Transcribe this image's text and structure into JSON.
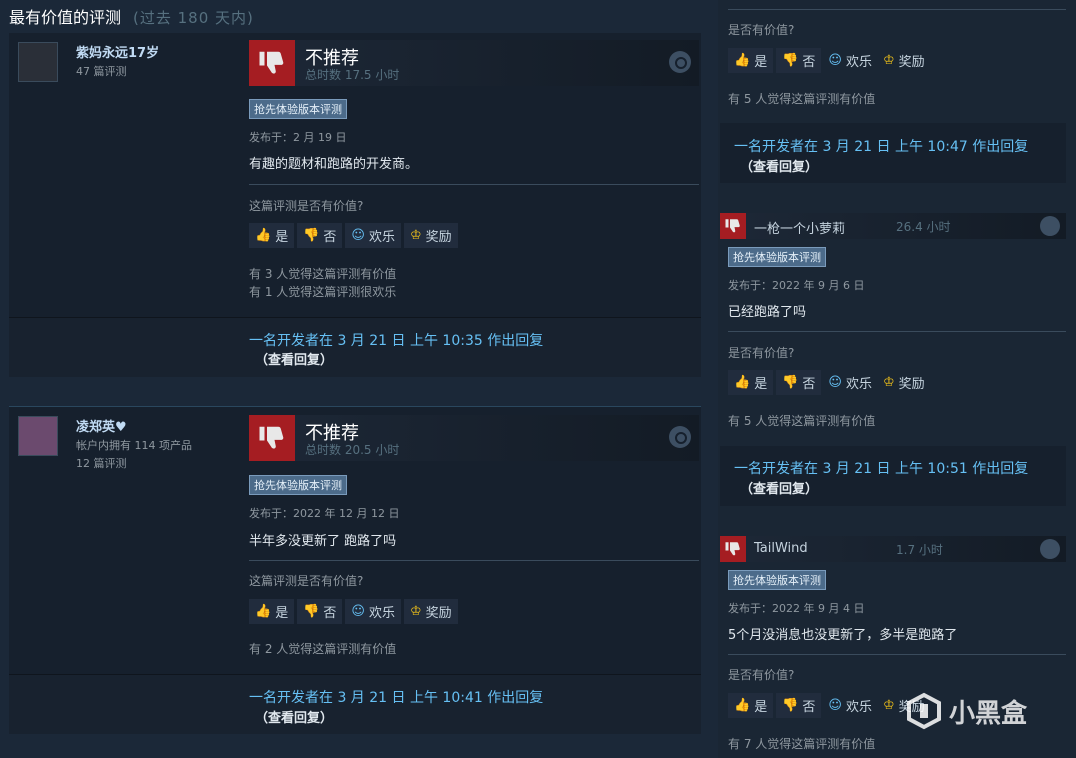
{
  "section": {
    "title": "最有价值的评测",
    "subtitle": "(过去 180 天内)"
  },
  "reviews": [
    {
      "author": "紫妈永远17岁",
      "meta1": "47 篇评测",
      "meta2": "",
      "verdict": "不推荐",
      "hours": "总时数 17.5 小时",
      "tag": "抢先体验版本评测",
      "posted": "发布于：2 月 19 日",
      "text": "有趣的题材和跑路的开发商。",
      "helpful_q": "这篇评测是否有价值?",
      "stat1": "有 3 人觉得这篇评测有价值",
      "stat2": "有 1 人觉得这篇评测很欢乐",
      "dev_reply": "一名开发者在 3 月 21 日 上午 10:35 作出回复",
      "view_reply": "（查看回复）"
    },
    {
      "author": "凌郑英♥",
      "meta1": "帐户内拥有 114 项产品",
      "meta2": "12 篇评测",
      "verdict": "不推荐",
      "hours": "总时数 20.5 小时",
      "tag": "抢先体验版本评测",
      "posted": "发布于：2022 年 12 月 12 日",
      "text": "半年多没更新了 跑路了吗",
      "helpful_q": "这篇评测是否有价值?",
      "stat1": "有 2 人觉得这篇评测有价值",
      "stat2": "",
      "dev_reply": "一名开发者在 3 月 21 日 上午 10:41 作出回复",
      "view_reply": "（查看回复）"
    }
  ],
  "vote_labels": {
    "yes": "是",
    "no": "否",
    "funny": "欢乐",
    "award": "奖励"
  },
  "right": {
    "top": {
      "helpful_q": "是否有价值?",
      "stat": "有 5 人觉得这篇评测有价值",
      "dev_reply": "一名开发者在 3 月 21 日 上午 10:47 作出回复",
      "view_reply": "（查看回复）"
    },
    "reviews": [
      {
        "author": "一枪一个小萝莉",
        "hours": "26.4 小时",
        "tag": "抢先体验版本评测",
        "posted": "发布于：2022 年 9 月 6 日",
        "text": "已经跑路了吗",
        "helpful_q": "是否有价值?",
        "stat": "有 5 人觉得这篇评测有价值",
        "dev_reply": "一名开发者在 3 月 21 日 上午 10:51 作出回复",
        "view_reply": "（查看回复）"
      },
      {
        "author": "TailWind",
        "hours": "1.7 小时",
        "tag": "抢先体验版本评测",
        "posted": "发布于：2022 年 9 月 4 日",
        "text": "5个月没消息也没更新了，多半是跑路了",
        "helpful_q": "是否有价值?",
        "stat": "有 7 人觉得这篇评测有价值"
      }
    ]
  },
  "watermark": "小黑盒",
  "icons": [
    "thumbs-down-icon",
    "thumbs-up-icon",
    "smiley-icon",
    "award-icon",
    "steam-icon"
  ]
}
